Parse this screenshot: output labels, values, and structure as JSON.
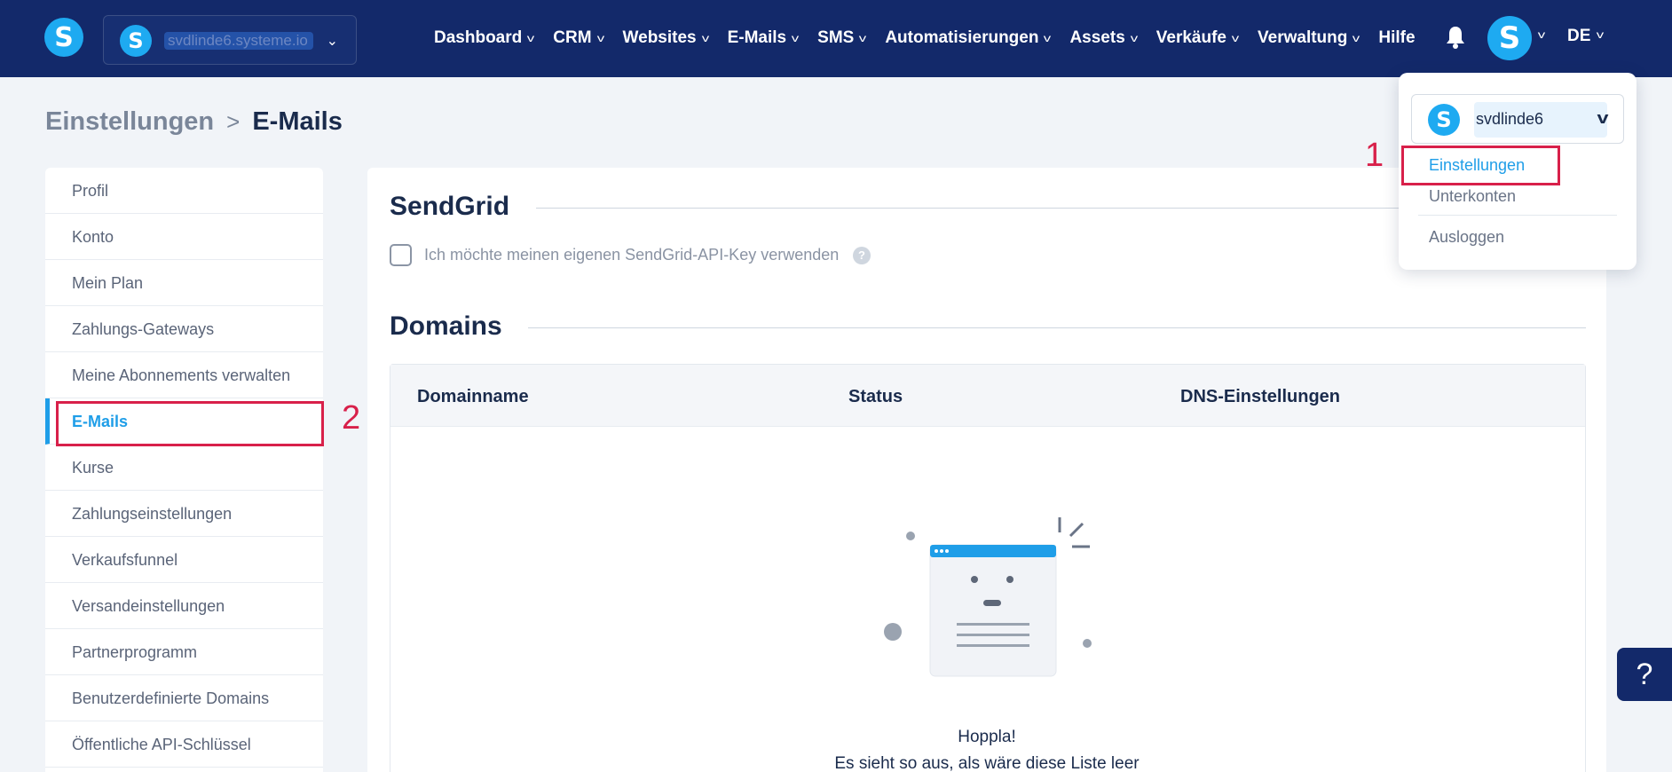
{
  "topbar": {
    "logo_letter": "S",
    "account_switcher": "svdlinde6.systeme.io",
    "nav": [
      {
        "label": "Dashboard"
      },
      {
        "label": "CRM"
      },
      {
        "label": "Websites"
      },
      {
        "label": "E-Mails"
      },
      {
        "label": "SMS"
      },
      {
        "label": "Automatisierungen"
      },
      {
        "label": "Assets"
      },
      {
        "label": "Verkäufe"
      },
      {
        "label": "Verwaltung"
      },
      {
        "label": "Hilfe"
      }
    ],
    "avatar_letter": "S",
    "language": "DE"
  },
  "breadcrumb": {
    "parent": "Einstellungen",
    "separator": ">",
    "current": "E-Mails"
  },
  "sidebar": {
    "items": [
      {
        "label": "Profil"
      },
      {
        "label": "Konto"
      },
      {
        "label": "Mein Plan"
      },
      {
        "label": "Zahlungs-Gateways"
      },
      {
        "label": "Meine Abonnements verwalten"
      },
      {
        "label": "E-Mails",
        "active": true
      },
      {
        "label": "Kurse"
      },
      {
        "label": "Zahlungseinstellungen"
      },
      {
        "label": "Verkaufsfunnel"
      },
      {
        "label": "Versandeinstellungen"
      },
      {
        "label": "Partnerprogramm"
      },
      {
        "label": "Benutzerdefinierte Domains"
      },
      {
        "label": "Öffentliche API-Schlüssel"
      }
    ]
  },
  "main": {
    "sendgrid_title": "SendGrid",
    "sendgrid_checkbox_label": "Ich möchte meinen eigenen SendGrid-API-Key verwenden",
    "help_icon": "?",
    "domains_title": "Domains",
    "table": {
      "columns": [
        "Domainname",
        "Status",
        "DNS-Einstellungen"
      ]
    },
    "empty_title": "Hoppla!",
    "empty_subtitle": "Es sieht so aus, als wäre diese Liste leer"
  },
  "dropdown": {
    "account_letter": "S",
    "account_name": "svdlinde6",
    "items": [
      {
        "label": "Einstellungen"
      },
      {
        "label": "Unterkonten"
      },
      {
        "label": "Ausloggen"
      }
    ]
  },
  "annotations": {
    "one": "1",
    "two": "2"
  },
  "help_button": "?",
  "colors": {
    "nav_bg": "#13296a",
    "accent": "#1f9ee8",
    "annotation": "#d8204a",
    "logo": "#1eaaf1"
  }
}
